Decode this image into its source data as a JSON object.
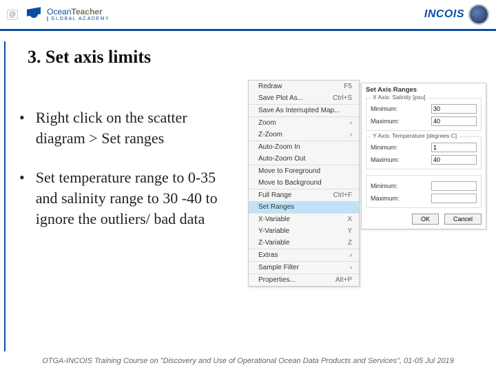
{
  "header": {
    "left_logo": {
      "brand_a": "Ocean",
      "brand_b": "Teacher",
      "sub": "GLOBAL ACADEMY",
      "badge": "@"
    },
    "right_logo": {
      "text": "INCOIS"
    }
  },
  "title": "3. Set axis limits",
  "bullets": [
    "Right click on the scatter diagram > Set ranges",
    "Set temperature range to 0-35 and salinity range to 30 -40 to ignore the outliers/ bad data"
  ],
  "context_menu": {
    "items": [
      {
        "label": "Redraw",
        "shortcut": "F5"
      },
      {
        "label": "Save Plot As...",
        "shortcut": "Ctrl+S"
      },
      {
        "label": "Save As Interrupted Map...",
        "sep": true,
        "shortcut": ""
      },
      {
        "label": "Zoom",
        "sep": true,
        "arrow": "›"
      },
      {
        "label": "Z-Zoom",
        "arrow": "›"
      },
      {
        "label": "Auto-Zoom In",
        "sep": true,
        "shortcut": ""
      },
      {
        "label": "Auto-Zoom Out",
        "shortcut": ""
      },
      {
        "label": "Move to Foreground",
        "sep": true,
        "shortcut": ""
      },
      {
        "label": "Move to Background",
        "shortcut": ""
      },
      {
        "label": "Full Range",
        "sep": true,
        "shortcut": "Ctrl+F"
      },
      {
        "label": "Set Ranges",
        "highlight": true,
        "shortcut": ""
      },
      {
        "label": "X-Variable",
        "sep": true,
        "shortcut": "X"
      },
      {
        "label": "Y-Variable",
        "shortcut": "Y"
      },
      {
        "label": "Z-Variable",
        "shortcut": "Z"
      },
      {
        "label": "Extras",
        "sep": true,
        "arrow": "›"
      },
      {
        "label": "Sample Filter",
        "sep": true,
        "arrow": "›"
      },
      {
        "label": "Properties...",
        "sep": true,
        "shortcut": "Alt+P"
      }
    ]
  },
  "dialog": {
    "title_text": "Set Axis Ranges",
    "groups": [
      {
        "legend": "X Axis: Salinity [psu]",
        "min_label": "Minimum:",
        "min": "30",
        "max_label": "Maximum:",
        "max": "40"
      },
      {
        "legend": "Y Axis: Temperature [degrees C]",
        "min_label": "Minimum:",
        "min": "1",
        "max_label": "Maximum:",
        "max": "40"
      },
      {
        "legend": "",
        "min_label": "Minimum:",
        "min": "",
        "max_label": "Maximum:",
        "max": ""
      }
    ],
    "ok": "OK",
    "cancel": "Cancel"
  },
  "footer": "OTGA-INCOIS Training Course on \"Discovery and Use of Operational Ocean Data Products and Services\", 01-05 Jul 2019"
}
